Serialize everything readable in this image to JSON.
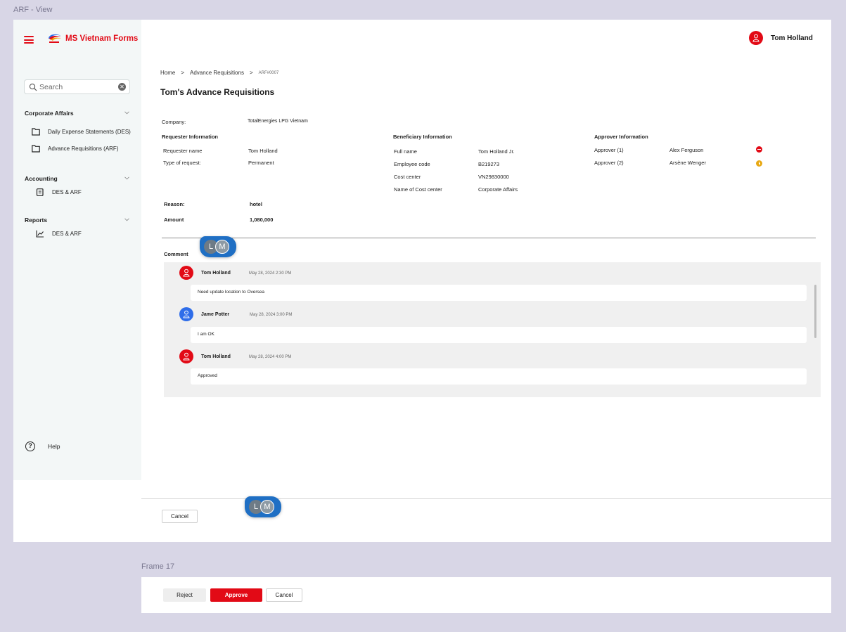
{
  "frames": {
    "main_title": "ARF - View",
    "secondary_title": "Frame 17"
  },
  "colors": {
    "brand_red": "#e20a16",
    "sidebar_bg": "#f3f7f7",
    "comment_bg": "#f0f0f0",
    "presence_blue": "#1f6fc4",
    "status_amber": "#e8a812",
    "avatar_blue": "#2f6de9"
  },
  "app": {
    "name": "MS Vietnam Forms"
  },
  "header": {
    "user_name": "Tom Holland",
    "user_icon": "user-icon"
  },
  "search": {
    "placeholder": "Search"
  },
  "sidebar": {
    "groups": [
      {
        "label": "Corporate Affairs",
        "items": [
          {
            "label": "Daily Expense Statements (DES)",
            "icon": "folder-icon"
          },
          {
            "label": "Advance Requisitions (ARF)",
            "icon": "folder-icon"
          }
        ]
      },
      {
        "label": "Accounting",
        "items": [
          {
            "label": "DES & ARF",
            "icon": "document-icon"
          }
        ]
      },
      {
        "label": "Reports",
        "items": [
          {
            "label": "DES & ARF",
            "icon": "chart-icon"
          }
        ]
      }
    ],
    "help": "Help"
  },
  "breadcrumb": {
    "home": "Home",
    "section": "Advance Requisitions",
    "current": "ARF#0007",
    "separator": ">"
  },
  "page_title": "Tom's Advance Requisitions",
  "company": {
    "label": "Company:",
    "value": "TotalEnergies LPG Vietnam"
  },
  "requester": {
    "heading": "Requester Information",
    "name_label": "Requester name",
    "name_value": "Tom Holland",
    "type_label": "Type of request:",
    "type_value": "Permanent"
  },
  "beneficiary": {
    "heading": "Beneficiary Information",
    "fields": [
      {
        "label": "Full name",
        "value": "Tom Holland Jr."
      },
      {
        "label": "Employee code",
        "value": "B219273"
      },
      {
        "label": "Cost center",
        "value": "VN29830000"
      },
      {
        "label": "Name of Cost center",
        "value": "Corporate Affairs"
      }
    ]
  },
  "approver": {
    "heading": "Approver Information",
    "rows": [
      {
        "label": "Approver (1)",
        "value": "Alex Ferguson",
        "status": "rejected"
      },
      {
        "label": "Approver (2)",
        "value": "Arsène Wenger",
        "status": "pending"
      }
    ]
  },
  "reason": {
    "label": "Reason:",
    "value": "hotel"
  },
  "amount": {
    "label": "Amount",
    "value": "1,080,000"
  },
  "comments": {
    "heading": "Comment",
    "items": [
      {
        "author": "Tom Holland",
        "time": "May 28, 2024 2:30 PM",
        "text": "Need update location to Oversea",
        "avatar_color": "red"
      },
      {
        "author": "Jame Potter",
        "time": "May 28, 2024 3:00 PM",
        "text": "I am OK",
        "avatar_color": "blue"
      },
      {
        "author": "Tom Holland",
        "time": "May 28, 2024 4:00 PM",
        "text": "Approved",
        "avatar_color": "red"
      }
    ]
  },
  "presence": {
    "initials": [
      "L",
      "M"
    ]
  },
  "footer": {
    "cancel": "Cancel"
  },
  "frame17": {
    "reject": "Reject",
    "approve": "Approve",
    "cancel": "Cancel"
  }
}
